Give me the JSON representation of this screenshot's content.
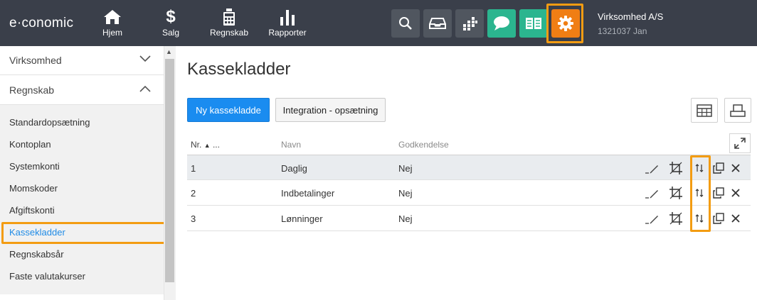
{
  "app": {
    "logo": "e·conomic"
  },
  "topnav": [
    {
      "label": "Hjem",
      "icon": "home-icon"
    },
    {
      "label": "Salg",
      "icon": "dollar-icon"
    },
    {
      "label": "Regnskab",
      "icon": "calculator-icon"
    },
    {
      "label": "Rapporter",
      "icon": "bar-chart-icon"
    }
  ],
  "toolbar_icons": [
    "search-icon",
    "inbox-icon",
    "apps-icon",
    "chat-icon",
    "book-icon",
    "gear-icon"
  ],
  "company": {
    "name": "Virksomhed A/S",
    "sub": "1321037 Jan"
  },
  "sidebar": {
    "sections": [
      {
        "label": "Virksomhed",
        "expanded": false
      },
      {
        "label": "Regnskab",
        "expanded": true
      }
    ],
    "items": [
      {
        "label": "Standardopsætning"
      },
      {
        "label": "Kontoplan"
      },
      {
        "label": "Systemkonti"
      },
      {
        "label": "Momskoder"
      },
      {
        "label": "Afgiftskonti"
      },
      {
        "label": "Kassekladder",
        "active": true
      },
      {
        "label": "Regnskabsår"
      },
      {
        "label": "Faste valutakurser"
      }
    ]
  },
  "main": {
    "title": "Kassekladder",
    "new_button": "Ny kassekladde",
    "integration_button": "Integration - opsætning",
    "columns": {
      "nr": "Nr.",
      "nr_more": "...",
      "navn": "Navn",
      "godkendelse": "Godkendelse"
    },
    "rows": [
      {
        "nr": "1",
        "navn": "Daglig",
        "godkendelse": "Nej"
      },
      {
        "nr": "2",
        "navn": "Indbetalinger",
        "godkendelse": "Nej"
      },
      {
        "nr": "3",
        "navn": "Lønninger",
        "godkendelse": "Nej"
      }
    ]
  },
  "colors": {
    "topbar": "#3a3f4a",
    "primary": "#1a8cf0",
    "green": "#2bb58f",
    "orange": "#f07e14",
    "highlight": "#f39c12"
  }
}
